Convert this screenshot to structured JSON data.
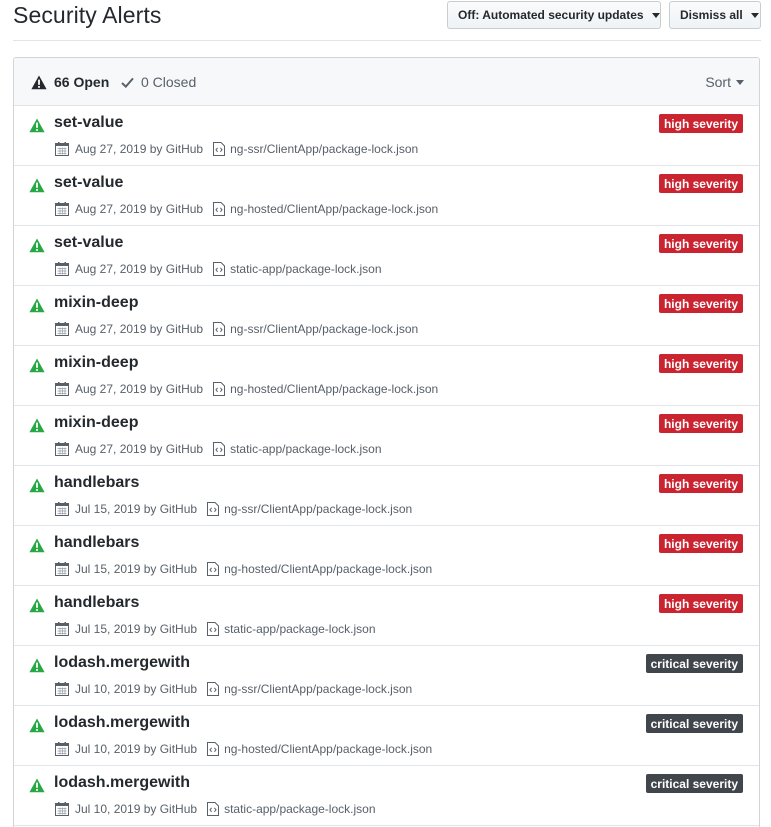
{
  "header": {
    "title": "Security Alerts",
    "updates_button": "Off: Automated security updates",
    "dismiss_button": "Dismiss all"
  },
  "filters": {
    "open_label": "66 Open",
    "closed_label": "0 Closed",
    "sort_label": "Sort"
  },
  "colors": {
    "high_badge": "#cb2431",
    "critical_badge": "#41464c",
    "alert_icon": "#28a745"
  },
  "alerts": [
    {
      "package": "set-value",
      "date": "Aug 27, 2019 by GitHub",
      "path": "ng-ssr/ClientApp/package-lock.json",
      "severity": "high severity",
      "level": "high"
    },
    {
      "package": "set-value",
      "date": "Aug 27, 2019 by GitHub",
      "path": "ng-hosted/ClientApp/package-lock.json",
      "severity": "high severity",
      "level": "high"
    },
    {
      "package": "set-value",
      "date": "Aug 27, 2019 by GitHub",
      "path": "static-app/package-lock.json",
      "severity": "high severity",
      "level": "high"
    },
    {
      "package": "mixin-deep",
      "date": "Aug 27, 2019 by GitHub",
      "path": "ng-ssr/ClientApp/package-lock.json",
      "severity": "high severity",
      "level": "high"
    },
    {
      "package": "mixin-deep",
      "date": "Aug 27, 2019 by GitHub",
      "path": "ng-hosted/ClientApp/package-lock.json",
      "severity": "high severity",
      "level": "high"
    },
    {
      "package": "mixin-deep",
      "date": "Aug 27, 2019 by GitHub",
      "path": "static-app/package-lock.json",
      "severity": "high severity",
      "level": "high"
    },
    {
      "package": "handlebars",
      "date": "Jul 15, 2019 by GitHub",
      "path": "ng-ssr/ClientApp/package-lock.json",
      "severity": "high severity",
      "level": "high"
    },
    {
      "package": "handlebars",
      "date": "Jul 15, 2019 by GitHub",
      "path": "ng-hosted/ClientApp/package-lock.json",
      "severity": "high severity",
      "level": "high"
    },
    {
      "package": "handlebars",
      "date": "Jul 15, 2019 by GitHub",
      "path": "static-app/package-lock.json",
      "severity": "high severity",
      "level": "high"
    },
    {
      "package": "lodash.mergewith",
      "date": "Jul 10, 2019 by GitHub",
      "path": "ng-ssr/ClientApp/package-lock.json",
      "severity": "critical severity",
      "level": "critical"
    },
    {
      "package": "lodash.mergewith",
      "date": "Jul 10, 2019 by GitHub",
      "path": "ng-hosted/ClientApp/package-lock.json",
      "severity": "critical severity",
      "level": "critical"
    },
    {
      "package": "lodash.mergewith",
      "date": "Jul 10, 2019 by GitHub",
      "path": "static-app/package-lock.json",
      "severity": "critical severity",
      "level": "critical"
    }
  ]
}
